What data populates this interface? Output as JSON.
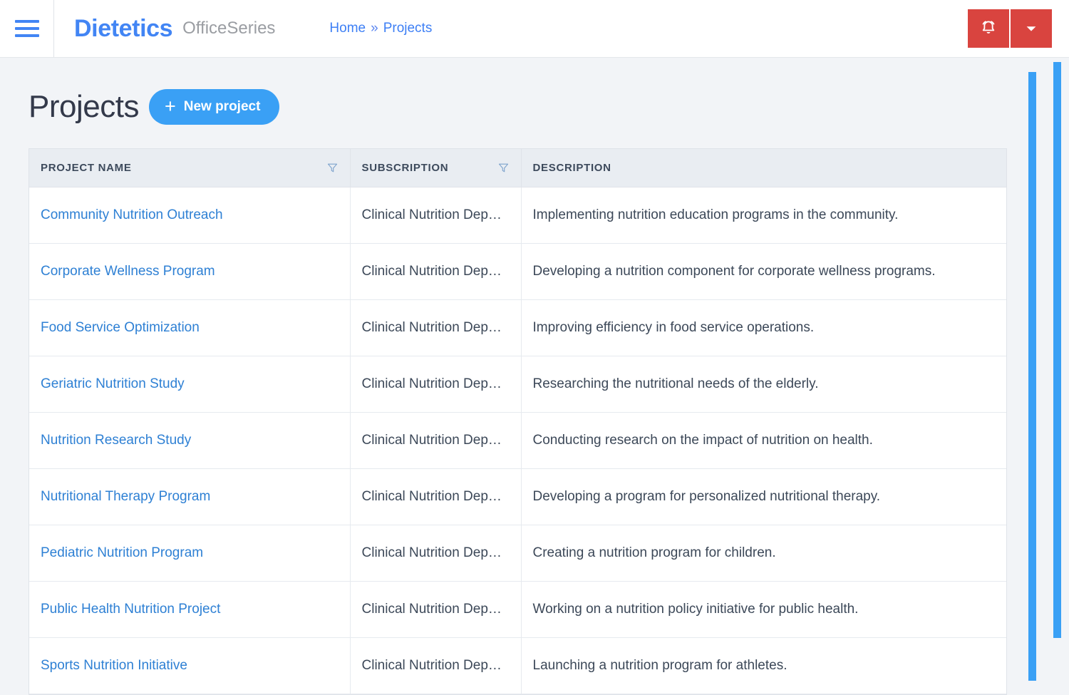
{
  "header": {
    "menu_icon": "hamburger-icon",
    "brand": "Dietetics",
    "brand_suffix": "OfficeSeries",
    "breadcrumb": {
      "home": "Home",
      "separator": "»",
      "current": "Projects"
    },
    "actions": [
      {
        "name": "notifications-button",
        "icon": "bell-icon"
      },
      {
        "name": "user-menu-button",
        "icon": "chevron-down-icon"
      }
    ],
    "action_bg_color": "#d9443f"
  },
  "page": {
    "title": "Projects",
    "new_project_label": "New project",
    "new_project_icon": "plus-icon",
    "accent_color": "#3aa0f5",
    "link_color": "#2e80d4"
  },
  "table": {
    "columns": [
      {
        "key": "name",
        "label": "PROJECT NAME",
        "filterable": true
      },
      {
        "key": "subscription",
        "label": "SUBSCRIPTION",
        "filterable": true
      },
      {
        "key": "description",
        "label": "DESCRIPTION",
        "filterable": false
      }
    ],
    "rows": [
      {
        "name": "Community Nutrition Outreach",
        "subscription": "Clinical Nutrition Dep…",
        "description": "Implementing nutrition education programs in the community."
      },
      {
        "name": "Corporate Wellness Program",
        "subscription": "Clinical Nutrition Dep…",
        "description": "Developing a nutrition component for corporate wellness programs."
      },
      {
        "name": "Food Service Optimization",
        "subscription": "Clinical Nutrition Dep…",
        "description": "Improving efficiency in food service operations."
      },
      {
        "name": "Geriatric Nutrition Study",
        "subscription": "Clinical Nutrition Dep…",
        "description": "Researching the nutritional needs of the elderly."
      },
      {
        "name": "Nutrition Research Study",
        "subscription": "Clinical Nutrition Dep…",
        "description": "Conducting research on the impact of nutrition on health."
      },
      {
        "name": "Nutritional Therapy Program",
        "subscription": "Clinical Nutrition Dep…",
        "description": "Developing a program for personalized nutritional therapy."
      },
      {
        "name": "Pediatric Nutrition Program",
        "subscription": "Clinical Nutrition Dep…",
        "description": "Creating a nutrition program for children."
      },
      {
        "name": "Public Health Nutrition Project",
        "subscription": "Clinical Nutrition Dep…",
        "description": "Working on a nutrition policy initiative for public health."
      },
      {
        "name": "Sports Nutrition Initiative",
        "subscription": "Clinical Nutrition Dep…",
        "description": "Launching a nutrition program for athletes."
      }
    ]
  },
  "scrollbars": {
    "inner": {
      "name": "inner-scrollbar-thumb",
      "color": "#3aa0f5"
    },
    "outer": {
      "name": "outer-scrollbar-thumb",
      "color": "#3aa0f5"
    }
  }
}
